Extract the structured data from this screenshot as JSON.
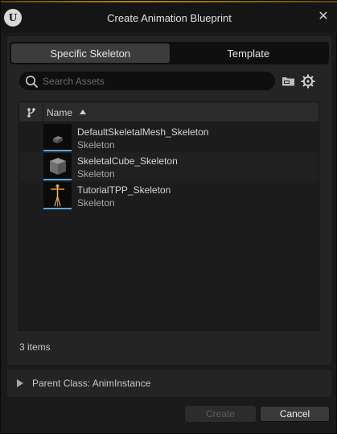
{
  "window": {
    "title": "Create Animation Blueprint",
    "logo_letter": "U",
    "close_glyph": "✕"
  },
  "tabs": [
    {
      "label": "Specific Skeleton",
      "active": true
    },
    {
      "label": "Template",
      "active": false
    }
  ],
  "search": {
    "placeholder": "Search Assets",
    "value": ""
  },
  "list": {
    "header": {
      "name_column": "Name",
      "sort": "ascending"
    },
    "items": [
      {
        "name": "DefaultSkeletalMesh_Skeleton",
        "type": "Skeleton",
        "thumbnail": "small-cube-mesh"
      },
      {
        "name": "SkeletalCube_Skeleton",
        "type": "Skeleton",
        "thumbnail": "grey-cube"
      },
      {
        "name": "TutorialTPP_Skeleton",
        "type": "Skeleton",
        "thumbnail": "mannequin-skeleton"
      }
    ],
    "count_label": "3 items"
  },
  "parent_class": {
    "label": "Parent Class: AnimInstance",
    "expanded": false
  },
  "buttons": {
    "create": "Create",
    "cancel": "Cancel"
  },
  "colors": {
    "accent_underline": "#5aa9d6",
    "active_tab": "#3c3c3c",
    "panel": "#242424"
  }
}
